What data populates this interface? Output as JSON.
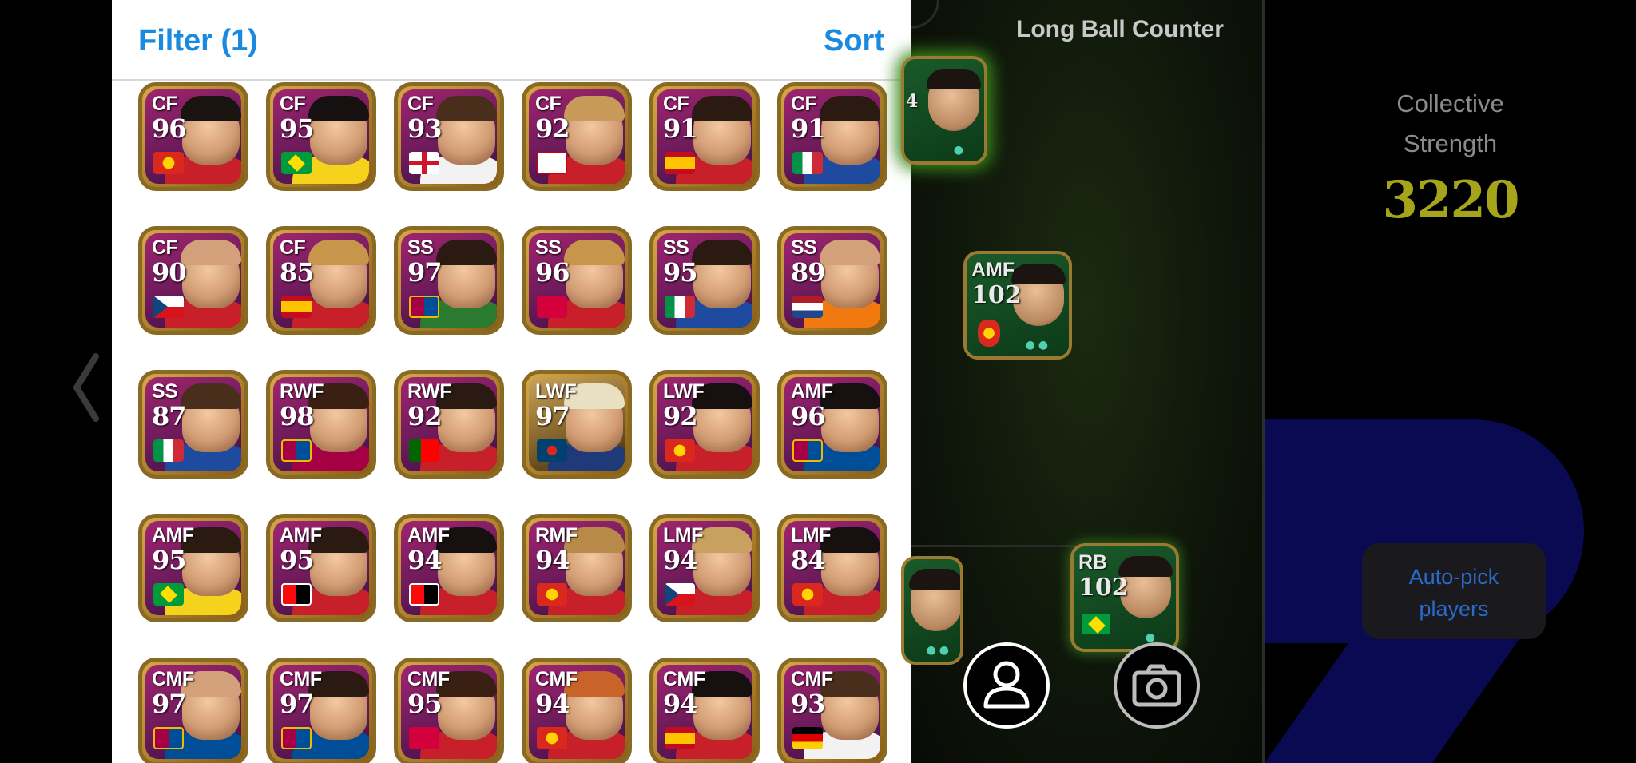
{
  "header": {
    "filter_label": "Filter (1)",
    "sort_label": "Sort"
  },
  "players": [
    {
      "pos": "CF",
      "rating": "96",
      "badge": "crest-manutd",
      "shirt": "#c8202a",
      "hair": "#1a1410"
    },
    {
      "pos": "CF",
      "rating": "95",
      "badge": "flag-brazil",
      "shirt": "#f5d21c",
      "hair": "#161010"
    },
    {
      "pos": "CF",
      "rating": "93",
      "badge": "flag-england",
      "shirt": "#f2f2f2",
      "hair": "#4a2e1c"
    },
    {
      "pos": "CF",
      "rating": "92",
      "badge": "crest-mdb",
      "shirt": "#c8202a",
      "hair": "#c89a5a"
    },
    {
      "pos": "CF",
      "rating": "91",
      "badge": "flag-spain",
      "shirt": "#c8202a",
      "hair": "#2a1a12"
    },
    {
      "pos": "CF",
      "rating": "91",
      "badge": "flag-italy",
      "shirt": "#1e4aa0",
      "hair": "#2a1a12"
    },
    {
      "pos": "CF",
      "rating": "90",
      "badge": "flag-czech",
      "shirt": "#c8202a",
      "hair": "#d2a07a"
    },
    {
      "pos": "CF",
      "rating": "85",
      "badge": "flag-spain",
      "shirt": "#c8202a",
      "hair": "#c8964a"
    },
    {
      "pos": "SS",
      "rating": "97",
      "badge": "crest-barca",
      "shirt": "#2a7a30",
      "hair": "#2a1a12"
    },
    {
      "pos": "SS",
      "rating": "96",
      "badge": "crest-mur",
      "shirt": "#c8202a",
      "hair": "#c8964a"
    },
    {
      "pos": "SS",
      "rating": "95",
      "badge": "flag-italy",
      "shirt": "#1e4aa0",
      "hair": "#2a1a12"
    },
    {
      "pos": "SS",
      "rating": "89",
      "badge": "flag-netherlands",
      "shirt": "#f07a10",
      "hair": "#d2a07a"
    },
    {
      "pos": "SS",
      "rating": "87",
      "badge": "flag-italy",
      "shirt": "#1e4aa0",
      "hair": "#4a2e1c"
    },
    {
      "pos": "RWF",
      "rating": "98",
      "badge": "crest-barca",
      "shirt": "#a50044",
      "hair": "#3a2012"
    },
    {
      "pos": "RWF",
      "rating": "92",
      "badge": "flag-portugal",
      "shirt": "#c8202a",
      "hair": "#2a1a12"
    },
    {
      "pos": "LWF",
      "rating": "97",
      "badge": "crest-psg",
      "shirt": "#1e3a78",
      "hair": "#e8e0c0",
      "gold": true
    },
    {
      "pos": "LWF",
      "rating": "92",
      "badge": "crest-manutd",
      "shirt": "#c8202a",
      "hair": "#161010"
    },
    {
      "pos": "AMF",
      "rating": "96",
      "badge": "crest-barca",
      "shirt": "#004d98",
      "hair": "#161010"
    },
    {
      "pos": "AMF",
      "rating": "95",
      "badge": "flag-brazil",
      "shirt": "#f5d21c",
      "hair": "#2a1a12"
    },
    {
      "pos": "AMF",
      "rating": "95",
      "badge": "crest-milan",
      "shirt": "#c8202a",
      "hair": "#2a1a12"
    },
    {
      "pos": "AMF",
      "rating": "94",
      "badge": "crest-milan",
      "shirt": "#c8202a",
      "hair": "#161010"
    },
    {
      "pos": "RMF",
      "rating": "94",
      "badge": "crest-manutd",
      "shirt": "#c8202a",
      "hair": "#b88a4a"
    },
    {
      "pos": "LMF",
      "rating": "94",
      "badge": "flag-czech",
      "shirt": "#c8202a",
      "hair": "#c8a060"
    },
    {
      "pos": "LMF",
      "rating": "84",
      "badge": "crest-manutd",
      "shirt": "#c8202a",
      "hair": "#161010"
    },
    {
      "pos": "CMF",
      "rating": "97",
      "badge": "crest-barca",
      "shirt": "#004d98",
      "hair": "#d2a07a"
    },
    {
      "pos": "CMF",
      "rating": "97",
      "badge": "crest-barca",
      "shirt": "#004d98",
      "hair": "#2a1a12"
    },
    {
      "pos": "CMF",
      "rating": "95",
      "badge": "crest-mur",
      "shirt": "#c8202a",
      "hair": "#3a2012"
    },
    {
      "pos": "CMF",
      "rating": "94",
      "badge": "crest-manutd",
      "shirt": "#c8202a",
      "hair": "#c8642a"
    },
    {
      "pos": "CMF",
      "rating": "94",
      "badge": "flag-spain",
      "shirt": "#c8202a",
      "hair": "#161010"
    },
    {
      "pos": "CMF",
      "rating": "93",
      "badge": "flag-germany",
      "shirt": "#f2f2f2",
      "hair": "#4a2e1c"
    }
  ],
  "formation": {
    "title": "Long Ball Counter",
    "players": [
      {
        "pos": "",
        "rating": "4"
      },
      {
        "pos": "AMF",
        "rating": "102"
      },
      {
        "pos": "RB",
        "rating": "102"
      }
    ]
  },
  "collective": {
    "label_line1": "Collective",
    "label_line2": "Strength",
    "value": "3220"
  },
  "autopick": {
    "line1": "Auto-pick",
    "line2": "players"
  },
  "colors": {
    "accent_blue": "#1a8ae0",
    "strength_yellow": "#a6a41a",
    "card_purple": "#8a1f6a",
    "card_gold_border": "#8a6a22"
  }
}
